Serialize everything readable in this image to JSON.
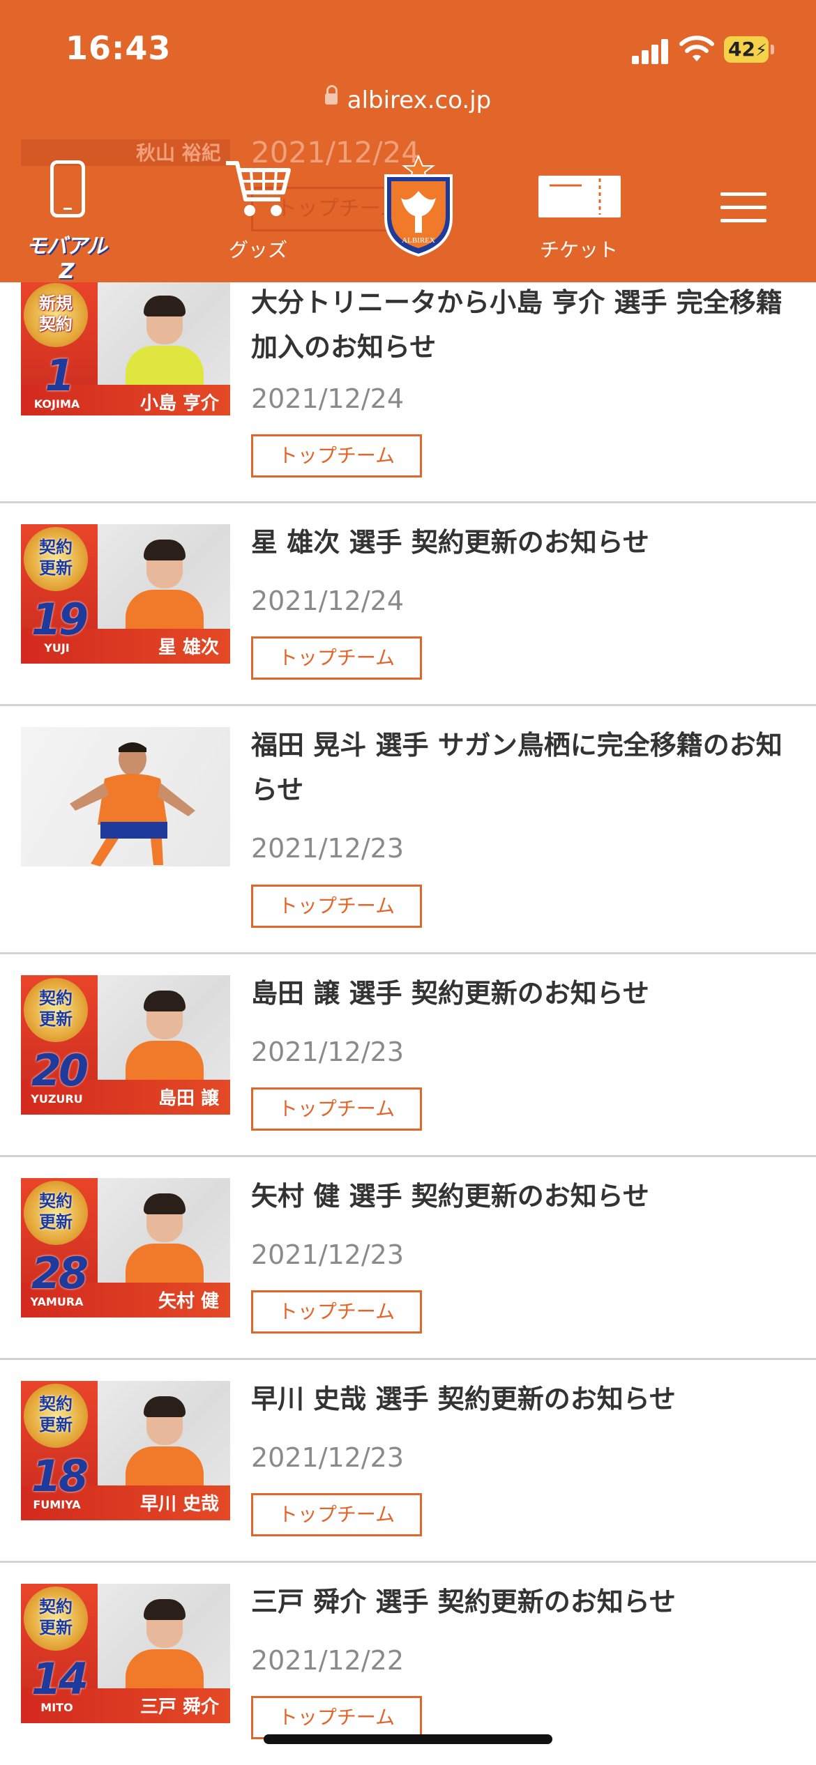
{
  "status": {
    "time": "16:43",
    "battery": "42"
  },
  "browser": {
    "url": "albirex.co.jp"
  },
  "ghost_row": {
    "name": "秋山 裕紀",
    "date": "2021/12/24",
    "tag": "トップチーム"
  },
  "nav": {
    "mobile_logo": "モバアルZ",
    "goods_label": "グッズ",
    "ticket_label": "チケット",
    "emblem_text": "ALBIREX"
  },
  "news": [
    {
      "title": "大分トリニータから小島 亨介 選手 完全移籍加入のお知らせ",
      "date": "2021/12/24",
      "tag": "トップチーム",
      "thumb": {
        "badge": "新規契約",
        "number": "1",
        "roman": "KOJIMA",
        "name": "小島 亨介"
      }
    },
    {
      "title": "星 雄次 選手 契約更新のお知らせ",
      "date": "2021/12/24",
      "tag": "トップチーム",
      "thumb": {
        "badge": "契約更新",
        "number": "19",
        "roman": "YUJI",
        "name": "星 雄次"
      }
    },
    {
      "title": "福田 晃斗 選手 サガン鳥栖に完全移籍のお知らせ",
      "date": "2021/12/23",
      "tag": "トップチーム",
      "thumb": {
        "photo": true
      }
    },
    {
      "title": "島田 譲 選手 契約更新のお知らせ",
      "date": "2021/12/23",
      "tag": "トップチーム",
      "thumb": {
        "badge": "契約更新",
        "number": "20",
        "roman": "YUZURU",
        "name": "島田 譲"
      }
    },
    {
      "title": "矢村 健 選手 契約更新のお知らせ",
      "date": "2021/12/23",
      "tag": "トップチーム",
      "thumb": {
        "badge": "契約更新",
        "number": "28",
        "roman": "YAMURA",
        "name": "矢村 健"
      }
    },
    {
      "title": "早川 史哉 選手 契約更新のお知らせ",
      "date": "2021/12/23",
      "tag": "トップチーム",
      "thumb": {
        "badge": "契約更新",
        "number": "18",
        "roman": "FUMIYA",
        "name": "早川 史哉"
      }
    },
    {
      "title": "三戸 舜介 選手 契約更新のお知らせ",
      "date": "2021/12/22",
      "tag": "トップチーム",
      "thumb": {
        "badge": "契約更新",
        "number": "14",
        "roman": "MITO",
        "name": "三戸 舜介"
      }
    }
  ],
  "colors": {
    "brand": "#e2652a",
    "navy": "#1d3a9c",
    "date_gray": "#8a8a8a"
  }
}
